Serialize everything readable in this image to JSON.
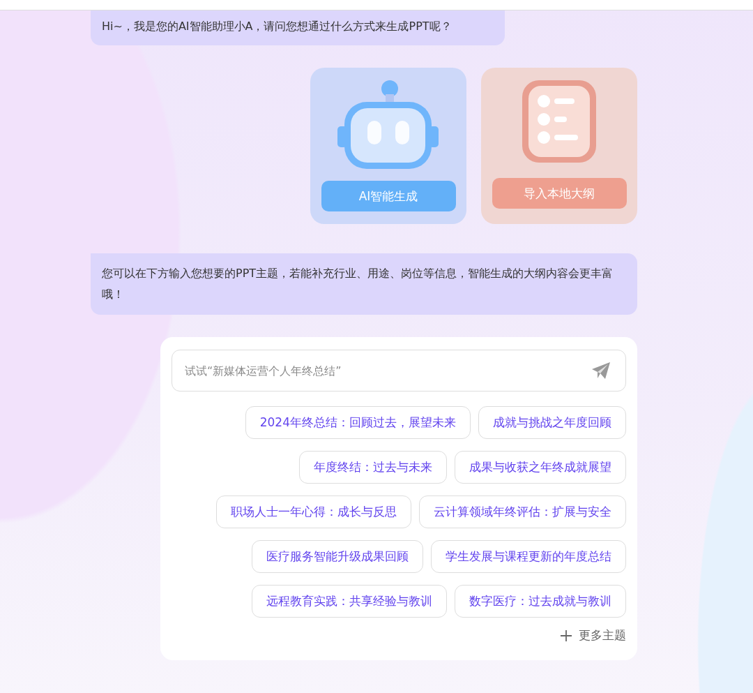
{
  "greeting": "Hi~，我是您的AI智能助理小A，请问您想通过什么方式来生成PPT呢？",
  "options": [
    {
      "kind": "robot",
      "label": "AI智能生成"
    },
    {
      "kind": "outline",
      "label": "导入本地大纲"
    }
  ],
  "hint": "您可以在下方输入您想要的PPT主题，若能补充行业、用途、岗位等信息，智能生成的大纲内容会更丰富哦！",
  "input": {
    "placeholder": "试试“新媒体运营个人年终总结”"
  },
  "topic_rows": [
    [
      "2024年终总结：回顾过去，展望未来",
      "成就与挑战之年度回顾"
    ],
    [
      "年度终结：过去与未来",
      "成果与收获之年终成就展望"
    ],
    [
      "职场人士一年心得：成长与反思",
      "云计算领域年终评估：扩展与安全"
    ],
    [
      "医疗服务智能升级成果回顾",
      "学生发展与课程更新的年度总结"
    ],
    [
      "远程教育实践：共享经验与教训",
      "数字医疗：过去成就与教训"
    ]
  ],
  "more": "更多主题"
}
